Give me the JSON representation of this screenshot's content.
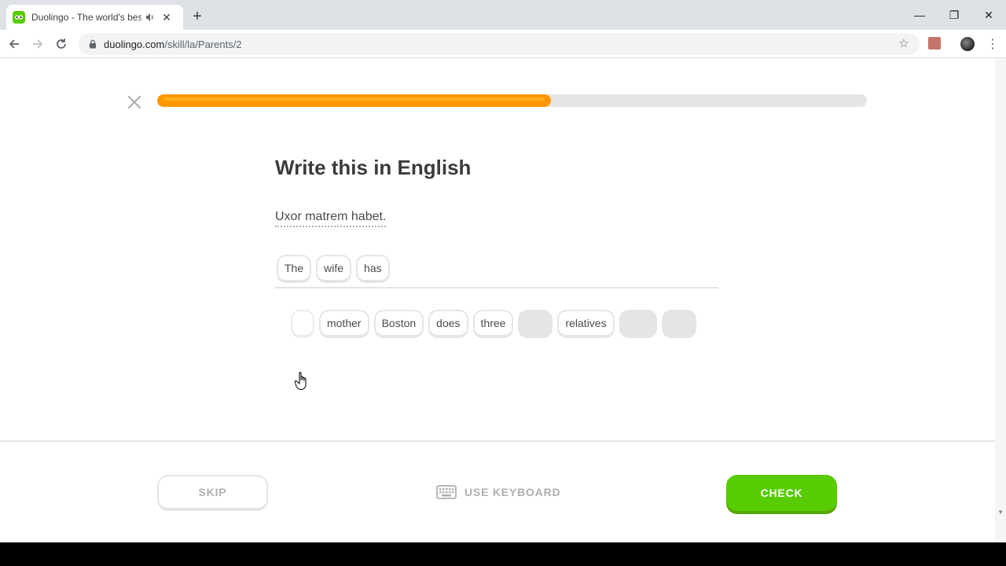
{
  "browser": {
    "tab_title": "Duolingo - The world's best",
    "tab_close": "✕",
    "new_tab": "+",
    "url_host": "duolingo.com",
    "url_path": "/skill/la/Parents/2",
    "window_controls": [
      "—",
      "❐",
      "✕"
    ]
  },
  "lesson": {
    "progress_percent": 55.5,
    "heading": "Write this in English",
    "prompt": "Uxor matrem habet.",
    "answer_words": [
      "The",
      "wife",
      "has"
    ],
    "word_bank": [
      "mother",
      "Boston",
      "does",
      "three",
      "relatives"
    ]
  },
  "footer": {
    "skip_label": "SKIP",
    "keyboard_label": "USE KEYBOARD",
    "check_label": "CHECK"
  },
  "colors": {
    "progress": "#ff9600",
    "check": "#58cc02",
    "brand": "#58cc02"
  }
}
